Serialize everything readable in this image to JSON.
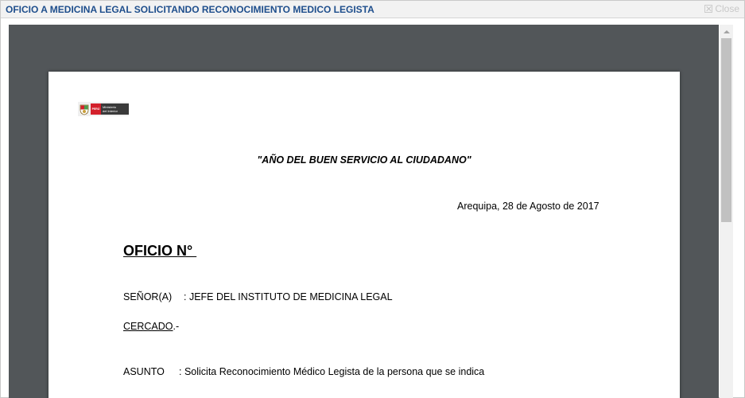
{
  "dialog": {
    "title": "OFICIO A MEDICINA LEGAL SOLICITANDO RECONOCIMIENTO MEDICO LEGISTA",
    "close_label": "Close"
  },
  "document": {
    "logo": {
      "red_text": "PERÚ",
      "ministry_text_1": "Ministerio",
      "ministry_text_2": "del Interior"
    },
    "motto": "\"AÑO DEL BUEN SERVICIO AL CIUDADANO\"",
    "date_line": "Arequipa, 28 de Agosto de 2017",
    "oficio_title": "OFICIO N° ",
    "senor_label": "SEÑOR(A)",
    "senor_value": ": JEFE DEL INSTITUTO DE MEDICINA LEGAL",
    "cercado_word": "CERCADO",
    "cercado_suffix": ".-",
    "asunto_label": "ASUNTO",
    "asunto_value": ": Solicita Reconocimiento Médico Legista de la persona que se indica"
  },
  "colors": {
    "title_text": "#1e4e8c",
    "viewer_background": "#525659",
    "logo_red": "#d3202b"
  }
}
